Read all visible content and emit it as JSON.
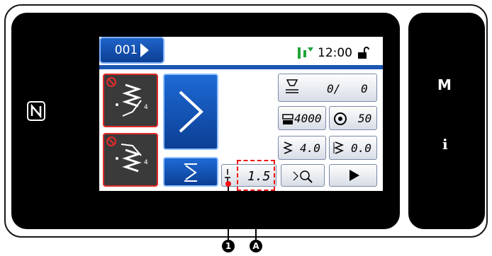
{
  "header": {
    "pattern_number": "001",
    "time": "12:00"
  },
  "right_panel": {
    "m_key": "M",
    "info_key": "i"
  },
  "values": {
    "counter": "0/",
    "counter_right": "0",
    "sewing_speed": "4000",
    "bobbin_value": "50",
    "stitch_pitch": "4.0",
    "stitch_pitch_2": "0.0",
    "setting_value": "1.5"
  },
  "callouts": {
    "a": "1",
    "b": "A"
  },
  "colors": {
    "accent_blue": "#1c56b3",
    "alert_red": "#e42b2b",
    "callout_dash": "#e11111"
  }
}
